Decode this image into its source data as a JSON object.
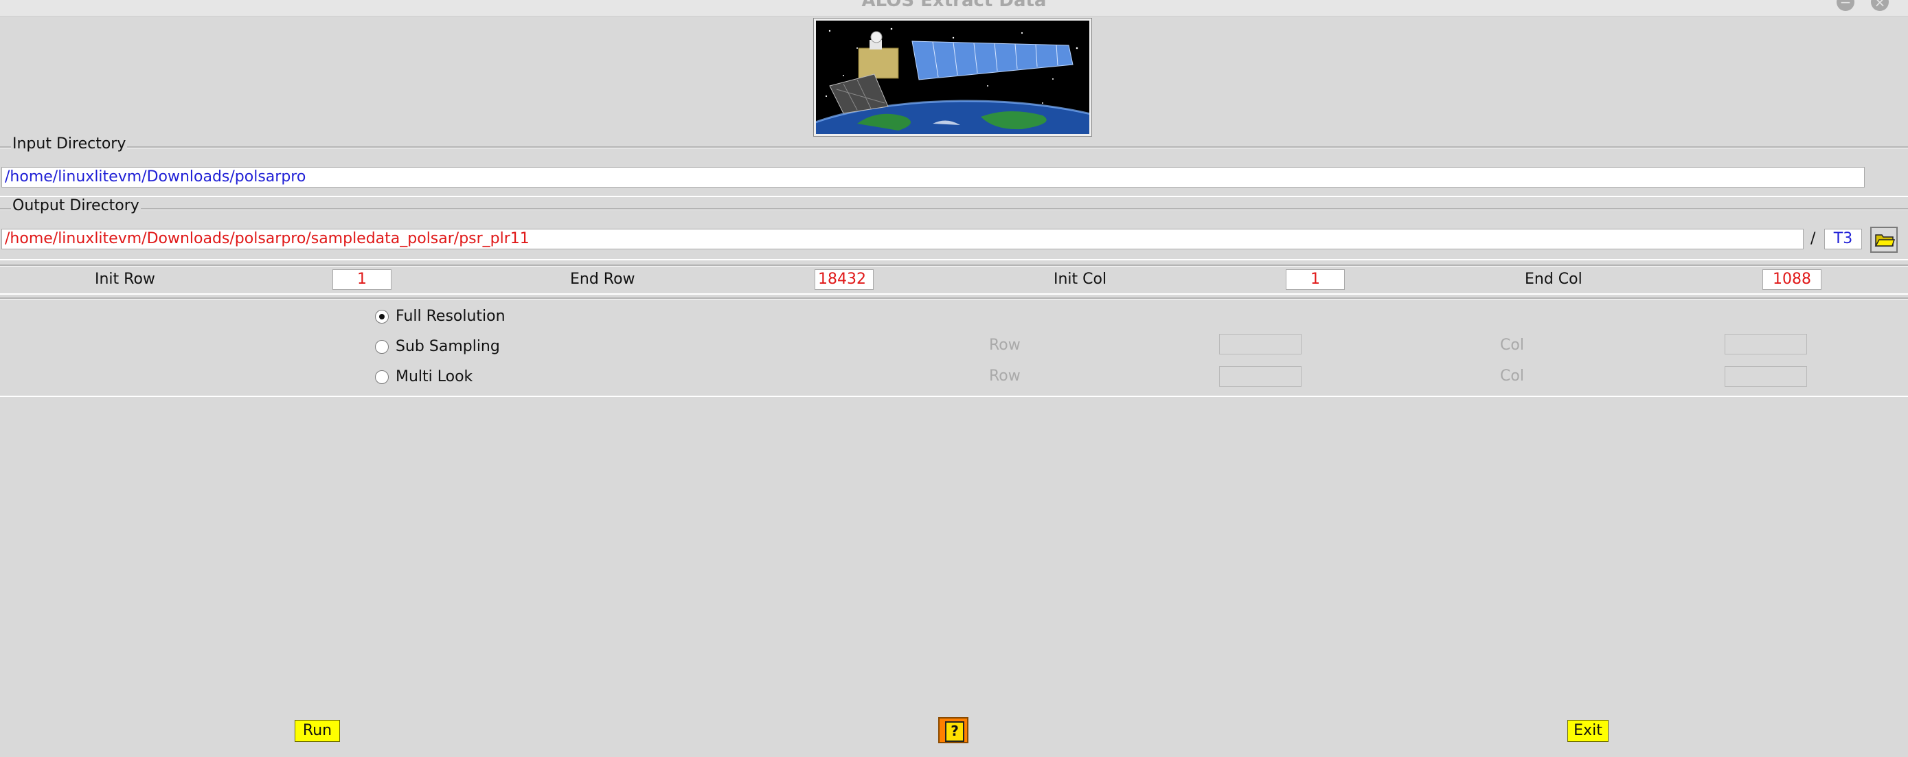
{
  "window": {
    "title": "ALOS Extract Data"
  },
  "input_dir": {
    "legend": "Input Directory",
    "path": "/home/linuxlitevm/Downloads/polsarpro"
  },
  "output_dir": {
    "legend": "Output Directory",
    "path": "/home/linuxlitevm/Downloads/polsarpro/sampledata_polsar/psr_plr11",
    "separator": "/",
    "suffix": "T3"
  },
  "rows_cols": {
    "init_row_label": "Init Row",
    "init_row": "1",
    "end_row_label": "End Row",
    "end_row": "18432",
    "init_col_label": "Init Col",
    "init_col": "1",
    "end_col_label": "End Col",
    "end_col": "1088"
  },
  "resolution": {
    "selected": "full",
    "full_label": "Full Resolution",
    "sub_label": "Sub Sampling",
    "multi_label": "Multi Look",
    "row_label": "Row",
    "col_label": "Col"
  },
  "buttons": {
    "run": "Run",
    "help": "?",
    "exit": "Exit"
  },
  "icons": {
    "folder": "folder-open-icon",
    "help": "help-icon"
  },
  "colors": {
    "input_path": "#1f1fd6",
    "output_path": "#e01818",
    "button_bg": "#ffff00",
    "help_bg": "#ff8000"
  }
}
